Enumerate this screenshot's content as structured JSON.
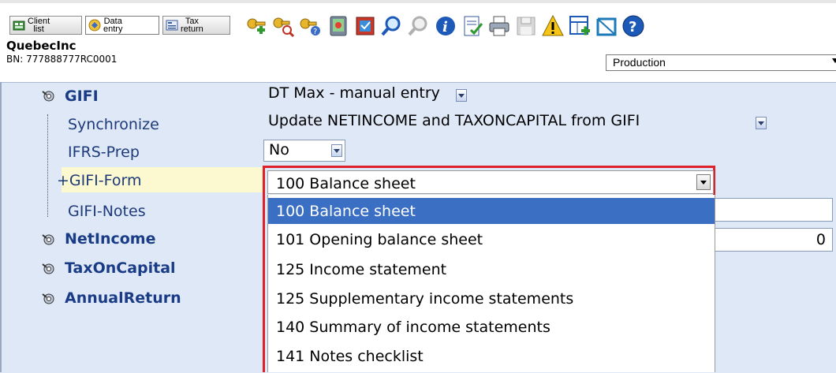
{
  "nav": {
    "client_list": "Client\nlist",
    "data_entry": "Data\nentry",
    "tax_return": "Tax\nreturn"
  },
  "toolbar_icons": [
    "add-key-icon",
    "search-key-icon",
    "key-question-icon",
    "tablet-icon",
    "book-icon",
    "zoom-icon",
    "zoom-disabled-icon",
    "info-icon",
    "document-check-icon",
    "printer-icon",
    "save-disabled-icon",
    "warning-icon",
    "add-form-icon",
    "window-icon",
    "help-icon"
  ],
  "client": {
    "name": "QuebecInc",
    "bn": "BN: 777888777RC0001"
  },
  "environment": "Production",
  "tree": {
    "gifi": "GIFI",
    "synchronize": "Synchronize",
    "ifrs_prep": "IFRS-Prep",
    "gifi_form": "+GIFI-Form",
    "gifi_notes": "GIFI-Notes",
    "netincome": "NetIncome",
    "taxoncapital": "TaxOnCapital",
    "annualreturn": "AnnualReturn"
  },
  "fields": {
    "gifi_value": "DT Max - manual entry",
    "synchronize_value": "Update NETINCOME and TAXONCAPITAL from GIFI",
    "ifrs_value": "No",
    "netincome_value": "0"
  },
  "gifi_form_dropdown": {
    "current": "100  Balance sheet",
    "options": [
      "100  Balance sheet",
      "101  Opening balance sheet",
      "125  Income statement",
      "125  Supplementary income statements",
      "140  Summary of income statements",
      "141  Notes checklist"
    ],
    "selected_index": 0
  },
  "colors": {
    "panel_bg": "#dfe8f6",
    "label_blue": "#1d3a7a",
    "selection_blue": "#3a6fc4",
    "highlight_red": "#e0202a"
  }
}
